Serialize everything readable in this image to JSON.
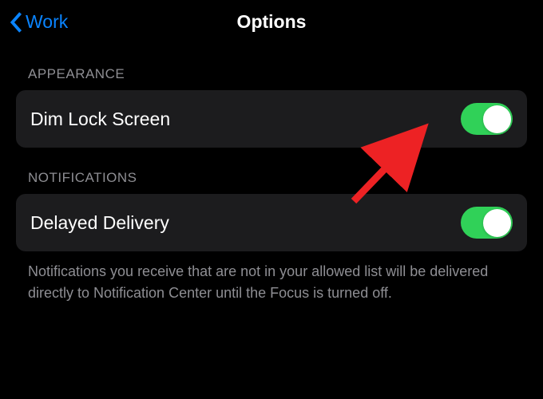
{
  "navbar": {
    "back_label": "Work",
    "title": "Options"
  },
  "sections": {
    "appearance": {
      "header": "APPEARANCE",
      "dim_lock_screen": {
        "label": "Dim Lock Screen",
        "enabled": true
      }
    },
    "notifications": {
      "header": "NOTIFICATIONS",
      "delayed_delivery": {
        "label": "Delayed Delivery",
        "enabled": true
      },
      "footer": "Notifications you receive that are not in your allowed list will be delivered directly to Notification Center until the Focus is turned off."
    }
  },
  "colors": {
    "accent_blue": "#0a84ff",
    "toggle_green": "#30d158",
    "cell_bg": "#1c1c1e",
    "secondary_text": "#8e8e93"
  },
  "annotation": {
    "arrow_color": "#ed2224"
  }
}
